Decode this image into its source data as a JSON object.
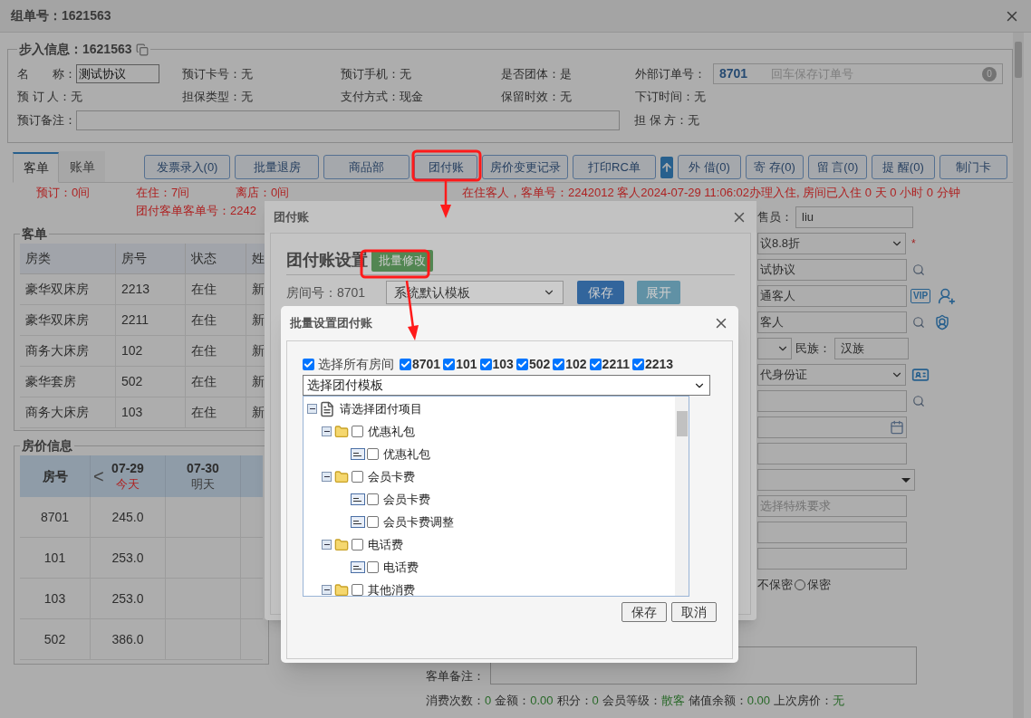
{
  "window": {
    "title": "组单号：1621563"
  },
  "booking": {
    "legend": "步入信息：1621563",
    "rows": [
      [
        {
          "kind": "input",
          "label": "名　　称：",
          "value": "测试协议"
        },
        {
          "kind": "text",
          "label": "预订卡号：",
          "value": "无"
        },
        {
          "kind": "text",
          "label": "预订手机：",
          "value": "无"
        },
        {
          "kind": "text",
          "label": "是否团体：",
          "value": "是"
        },
        {
          "kind": "order",
          "label": "外部订单号：",
          "value": "8701",
          "placeholder": "回车保存订单号",
          "badge": "0"
        }
      ],
      [
        {
          "kind": "text",
          "label": "预 订 人：",
          "value": "无"
        },
        {
          "kind": "text",
          "label": "担保类型：",
          "value": "无"
        },
        {
          "kind": "text",
          "label": "支付方式：",
          "value": "现金"
        },
        {
          "kind": "text",
          "label": "保留时效：",
          "value": "无"
        },
        {
          "kind": "text",
          "label": "下订时间：",
          "value": "无"
        }
      ]
    ],
    "remark_label": "预订备注：",
    "guarantor": "担 保 方：无"
  },
  "tabs": [
    {
      "label": "客单",
      "selected": true
    },
    {
      "label": "账单",
      "selected": false
    }
  ],
  "toolbar": [
    {
      "kind": "button",
      "label": "发票录入(0)"
    },
    {
      "kind": "button",
      "label": "批量退房"
    },
    {
      "kind": "button",
      "label": "商品部"
    },
    {
      "kind": "button",
      "label": "团付账"
    },
    {
      "kind": "button",
      "label": "房价变更记录"
    },
    {
      "kind": "button",
      "label": "打印RC单"
    },
    {
      "kind": "up_icon"
    },
    {
      "kind": "button",
      "label": "外 借(0)"
    },
    {
      "kind": "button",
      "label": "寄 存(0)"
    },
    {
      "kind": "button",
      "label": "留 言(0)"
    },
    {
      "kind": "button",
      "label": "提 醒(0)"
    },
    {
      "kind": "button",
      "label": "制门卡"
    }
  ],
  "summary": {
    "counts": [
      "预订：0间",
      "在住：7间",
      "离店：0间"
    ],
    "notice": "在住客人，客单号：2242012 客人2024-07-29 11:06:02办理入住, 房间已入住 0 天 0 小时 0 分钟",
    "group_order": "团付客单客单号：2242"
  },
  "guest_table": {
    "legend": "客单",
    "columns": [
      "房类",
      "房号",
      "状态",
      "姓"
    ],
    "rows": [
      [
        "豪华双床房",
        "2213",
        "在住",
        "新"
      ],
      [
        "豪华双床房",
        "2211",
        "在住",
        "新"
      ],
      [
        "商务大床房",
        "102",
        "在住",
        "新"
      ],
      [
        "豪华套房",
        "502",
        "在住",
        "新"
      ],
      [
        "商务大床房",
        "103",
        "在住",
        "新"
      ]
    ]
  },
  "rate_table": {
    "legend": "房价信息",
    "room_header": "房号",
    "prev": "<",
    "dates": [
      {
        "date": "07-29",
        "day": "今天",
        "today": true
      },
      {
        "date": "07-30",
        "day": "明天",
        "today": false
      }
    ],
    "rows": [
      {
        "room": "8701",
        "rate": "245.0"
      },
      {
        "room": "101",
        "rate": "253.0"
      },
      {
        "room": "103",
        "rate": "253.0"
      },
      {
        "room": "502",
        "rate": "386.0"
      }
    ]
  },
  "guest_form": [
    {
      "kind": "labeled_input",
      "label": "售员：",
      "value": "liu"
    },
    {
      "kind": "select",
      "value": "议8.8折",
      "required": "*"
    },
    {
      "kind": "input_search",
      "value": "试协议"
    },
    {
      "kind": "input_vip",
      "value": "通客人",
      "badge": "VIP"
    },
    {
      "kind": "input_shield",
      "value": "客人"
    },
    {
      "kind": "ethnicity",
      "label": "民族：",
      "value": "汉族"
    },
    {
      "kind": "select_idcard",
      "value": "代身份证"
    },
    {
      "kind": "input_search"
    },
    {
      "kind": "input_calendar"
    },
    {
      "kind": "input"
    },
    {
      "kind": "dropdown"
    },
    {
      "kind": "input",
      "placeholder": "选择特殊要求"
    },
    {
      "kind": "input"
    },
    {
      "kind": "input"
    },
    {
      "kind": "privacy",
      "label": "不保密",
      "option": "保密",
      "selected": false
    }
  ],
  "remarks": {
    "label": "客单备注："
  },
  "stats": [
    {
      "label": "消费次数：",
      "value": "0"
    },
    {
      "label": "金额：",
      "value": "0.00"
    },
    {
      "label": "积分：",
      "value": "0"
    },
    {
      "label": "会员等级：",
      "value": "散客"
    },
    {
      "label": "储值余额：",
      "value": "0.00"
    },
    {
      "label": "上次房价：",
      "value": "无"
    }
  ],
  "group_dialog": {
    "title": "团付账",
    "heading": "团付账设置",
    "batch_button": "批量修改",
    "room_label": "房间号：8701",
    "template": "系统默认模板",
    "save": "保存",
    "expand": "展开"
  },
  "batch_dialog": {
    "title": "批量设置团付账",
    "select_all": {
      "label": "选择所有房间",
      "checked": true
    },
    "rooms": [
      {
        "label": "8701",
        "checked": true
      },
      {
        "label": "101",
        "checked": true
      },
      {
        "label": "103",
        "checked": true
      },
      {
        "label": "502",
        "checked": true
      },
      {
        "label": "102",
        "checked": true
      },
      {
        "label": "2211",
        "checked": true
      },
      {
        "label": "2213",
        "checked": true
      }
    ],
    "template_placeholder": "选择团付模板",
    "tree": {
      "label": "请选择团付项目",
      "expanded": true,
      "children": [
        {
          "label": "优惠礼包",
          "checked": false,
          "expanded": true,
          "children": [
            {
              "label": "优惠礼包",
              "checked": false
            }
          ]
        },
        {
          "label": "会员卡费",
          "checked": false,
          "expanded": true,
          "children": [
            {
              "label": "会员卡费",
              "checked": false
            },
            {
              "label": "会员卡费调整",
              "checked": false
            }
          ]
        },
        {
          "label": "电话费",
          "checked": false,
          "expanded": true,
          "children": [
            {
              "label": "电话费",
              "checked": false
            }
          ]
        },
        {
          "label": "其他消费",
          "checked": false,
          "expanded": true
        }
      ]
    },
    "buttons": [
      "保存",
      "取消"
    ]
  }
}
